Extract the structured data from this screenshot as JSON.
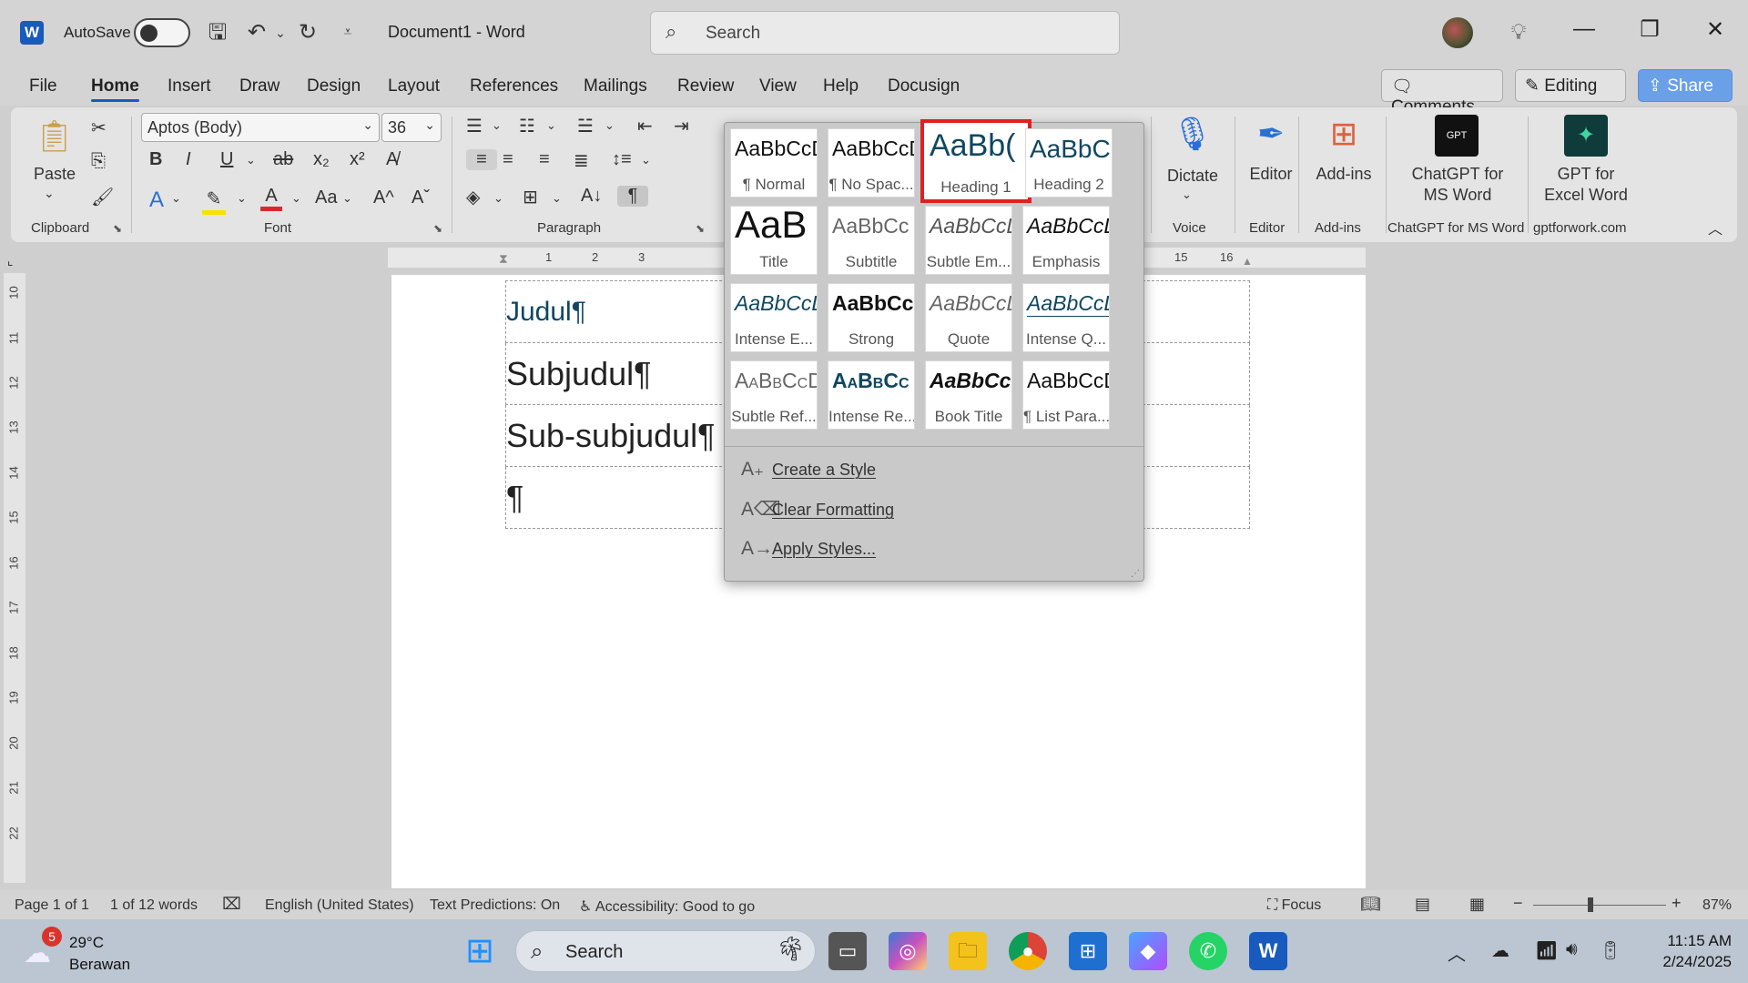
{
  "app": {
    "autosave_label": "AutoSave",
    "doc_title": "Document1  -  Word",
    "search_placeholder": "Search"
  },
  "menu": [
    "File",
    "Home",
    "Insert",
    "Draw",
    "Design",
    "Layout",
    "References",
    "Mailings",
    "Review",
    "View",
    "Help",
    "Docusign"
  ],
  "menu_right": {
    "comments": "Comments",
    "editing": "Editing",
    "share": "Share"
  },
  "ribbon": {
    "clipboard": {
      "paste": "Paste",
      "label": "Clipboard"
    },
    "font": {
      "name": "Aptos (Body)",
      "size": "36",
      "label": "Font"
    },
    "paragraph": {
      "label": "Paragraph"
    },
    "voice": {
      "dictate": "Dictate",
      "label": "Voice"
    },
    "editor": {
      "editor": "Editor",
      "label": "Editor"
    },
    "addins": {
      "addins": "Add-ins",
      "label": "Add-ins"
    },
    "chatgpt": {
      "line1": "ChatGPT for",
      "line2": "MS Word",
      "label": "ChatGPT for MS Word"
    },
    "gptexcel": {
      "line1": "GPT for",
      "line2": "Excel Word",
      "label": "gptforwork.com"
    }
  },
  "style_gallery": {
    "styles": [
      {
        "preview": "AaBbCcDd",
        "label": "¶ Normal"
      },
      {
        "preview": "AaBbCcDd",
        "label": "¶ No Spac..."
      },
      {
        "preview": "AaBb(",
        "label": "Heading 1"
      },
      {
        "preview": "AaBbC",
        "label": "Heading 2"
      },
      {
        "preview": "AaB",
        "label": "Title"
      },
      {
        "preview": "AaBbCc",
        "label": "Subtitle"
      },
      {
        "preview": "AaBbCcL",
        "label": "Subtle Em..."
      },
      {
        "preview": "AaBbCcL",
        "label": "Emphasis"
      },
      {
        "preview": "AaBbCcL",
        "label": "Intense E..."
      },
      {
        "preview": "AaBbCcl",
        "label": "Strong"
      },
      {
        "preview": "AaBbCcL",
        "label": "Quote"
      },
      {
        "preview": "AaBbCcL",
        "label": "Intense Q..."
      },
      {
        "preview": "AaBbCcD",
        "label": "Subtle Ref..."
      },
      {
        "preview": "AaBbCc",
        "label": "Intense Re..."
      },
      {
        "preview": "AaBbCci",
        "label": "Book Title"
      },
      {
        "preview": "AaBbCcD",
        "label": "¶ List Para..."
      }
    ],
    "selected_index": 2,
    "actions": [
      "Create a Style",
      "Clear Formatting",
      "Apply Styles..."
    ]
  },
  "document": {
    "rows": [
      "Judul¶",
      "Subjudul¶",
      "Sub-subjudul¶",
      "¶"
    ]
  },
  "ruler": {
    "marks": [
      "1",
      "2",
      "3",
      "15",
      "16"
    ],
    "vmarks": [
      "10",
      "11",
      "12",
      "13",
      "14",
      "15",
      "16",
      "17",
      "18",
      "19",
      "20",
      "21",
      "22"
    ]
  },
  "status": {
    "page": "Page 1 of 1",
    "words": "1 of 12 words",
    "language": "English (United States)",
    "predictions": "Text Predictions: On",
    "accessibility": "Accessibility: Good to go",
    "focus": "Focus",
    "zoom": "87%"
  },
  "taskbar": {
    "temp": "29°C",
    "weather": "Berawan",
    "badge": "5",
    "search": "Search",
    "time": "11:15 AM",
    "date": "2/24/2025"
  }
}
